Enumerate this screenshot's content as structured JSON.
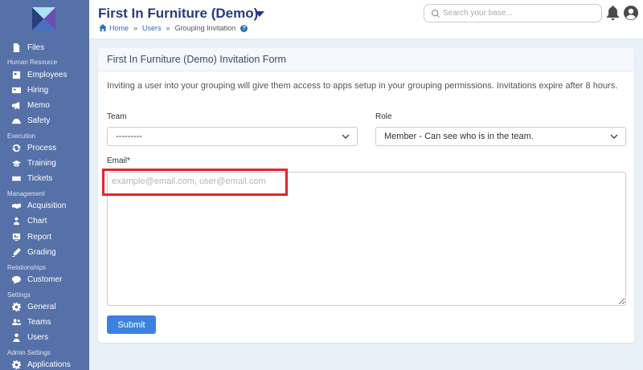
{
  "sidebar": {
    "items": [
      {
        "label": "Files",
        "icon": "file-icon"
      },
      {
        "label": "Employees",
        "icon": "id-card-icon"
      },
      {
        "label": "Hiring",
        "icon": "newspaper-icon"
      },
      {
        "label": "Memo",
        "icon": "megaphone-icon"
      },
      {
        "label": "Safety",
        "icon": "hard-hat-icon"
      },
      {
        "label": "Process",
        "icon": "sync-icon"
      },
      {
        "label": "Training",
        "icon": "graduation-cap-icon"
      },
      {
        "label": "Tickets",
        "icon": "ticket-icon"
      },
      {
        "label": "Acquisition",
        "icon": "handshake-icon"
      },
      {
        "label": "Chart",
        "icon": "users-icon"
      },
      {
        "label": "Report",
        "icon": "report-icon"
      },
      {
        "label": "Grading",
        "icon": "marker-icon"
      },
      {
        "label": "Customer",
        "icon": "comments-icon"
      },
      {
        "label": "General",
        "icon": "gear-icon"
      },
      {
        "label": "Teams",
        "icon": "users-icon"
      },
      {
        "label": "Users",
        "icon": "user-icon"
      },
      {
        "label": "Applications",
        "icon": "apps-icon"
      }
    ],
    "sections": {
      "human_resource": "Human Resource",
      "execution": "Execution",
      "management": "Management",
      "relationships": "Relationships",
      "settings": "Settings",
      "admin_settings": "Admin Settings"
    }
  },
  "header": {
    "title": "First In Furniture (Demo)",
    "breadcrumb": {
      "home": "Home",
      "users": "Users",
      "current": "Grouping Invitation",
      "separator": "»"
    },
    "help": "?",
    "search_placeholder": "Search your base..."
  },
  "form": {
    "title": "First In Furniture (Demo) Invitation Form",
    "intro": "Inviting a user into your grouping will give them access to apps setup in your grouping permissions. Invitations expire after 8 hours.",
    "team_label": "Team",
    "team_value": "---------",
    "role_label": "Role",
    "role_value": "Member - Can see who is in the team.",
    "email_label": "Email*",
    "email_placeholder": "example@email.com, user@email.com",
    "submit_label": "Submit"
  },
  "colors": {
    "sidebar": "#5670a8",
    "title": "#263b80",
    "link": "#2f6fb8",
    "button": "#3b82e0",
    "highlight": "#e0262b"
  }
}
